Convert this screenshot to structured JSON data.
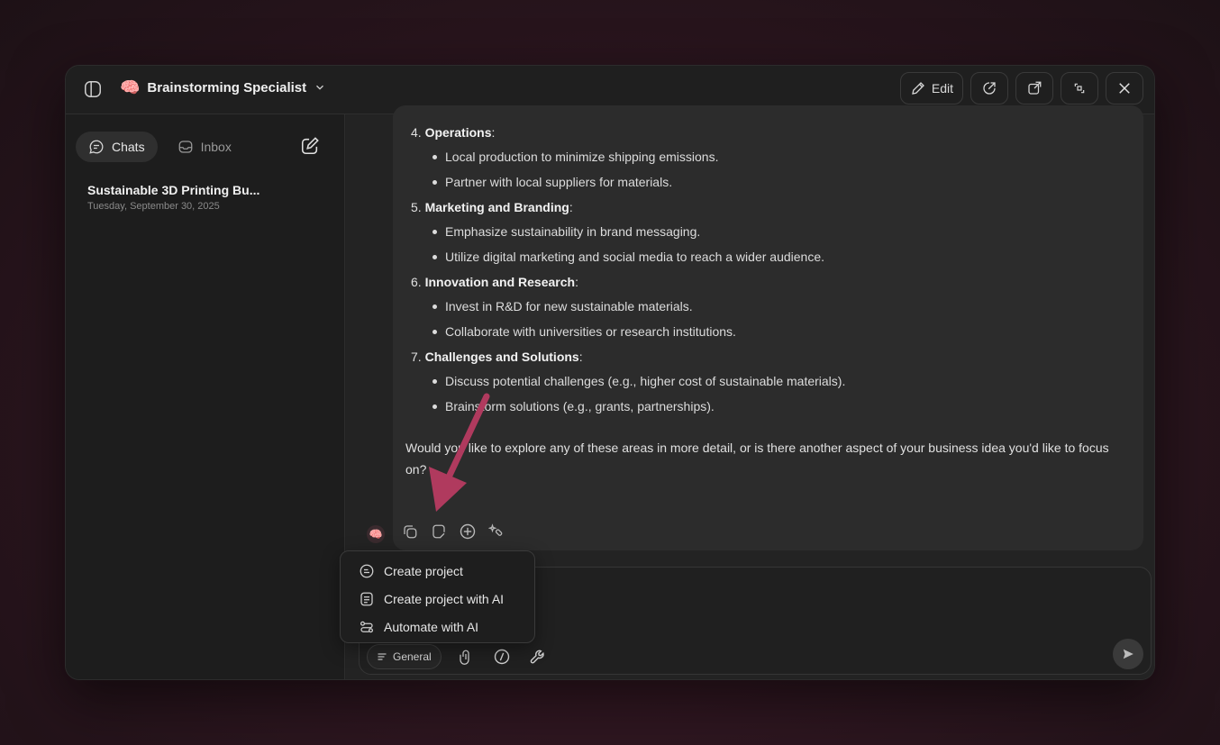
{
  "window": {
    "agent": {
      "emoji": "🧠",
      "name": "Brainstorming Specialist"
    },
    "toolbar": {
      "edit_label": "Edit"
    }
  },
  "sidebar": {
    "tabs": [
      {
        "label": "Chats",
        "icon": "chat-bubble-icon",
        "active": true
      },
      {
        "label": "Inbox",
        "icon": "inbox-icon",
        "active": false
      }
    ],
    "chats": [
      {
        "title": "Sustainable 3D Printing Bu...",
        "date": "Tuesday, September 30, 2025"
      }
    ]
  },
  "message": {
    "sections": [
      {
        "number": "4.",
        "title": "Operations",
        "bullets": [
          "Local production to minimize shipping emissions.",
          "Partner with local suppliers for materials."
        ]
      },
      {
        "number": "5.",
        "title": "Marketing and Branding",
        "bullets": [
          "Emphasize sustainability in brand messaging.",
          "Utilize digital marketing and social media to reach a wider audience."
        ]
      },
      {
        "number": "6.",
        "title": "Innovation and Research",
        "bullets": [
          "Invest in R&D for new sustainable materials.",
          "Collaborate with universities or research institutions."
        ]
      },
      {
        "number": "7.",
        "title": "Challenges and Solutions",
        "bullets": [
          "Discuss potential challenges (e.g., higher cost of sustainable materials).",
          "Brainstorm solutions (e.g., grants, partnerships)."
        ]
      }
    ],
    "closing": "Would you like to explore any of these areas in more detail, or is there another aspect of your business idea you'd like to focus on?"
  },
  "popup_menu": {
    "items": [
      {
        "label": "Create project",
        "icon": "project-icon"
      },
      {
        "label": "Create project with AI",
        "icon": "ai-project-icon"
      },
      {
        "label": "Automate with AI",
        "icon": "automate-icon"
      }
    ]
  },
  "composer": {
    "mode_label": "General"
  },
  "colors": {
    "accent_arrow": "#b03a5e",
    "background": "#2e1620",
    "window": "#222222"
  }
}
